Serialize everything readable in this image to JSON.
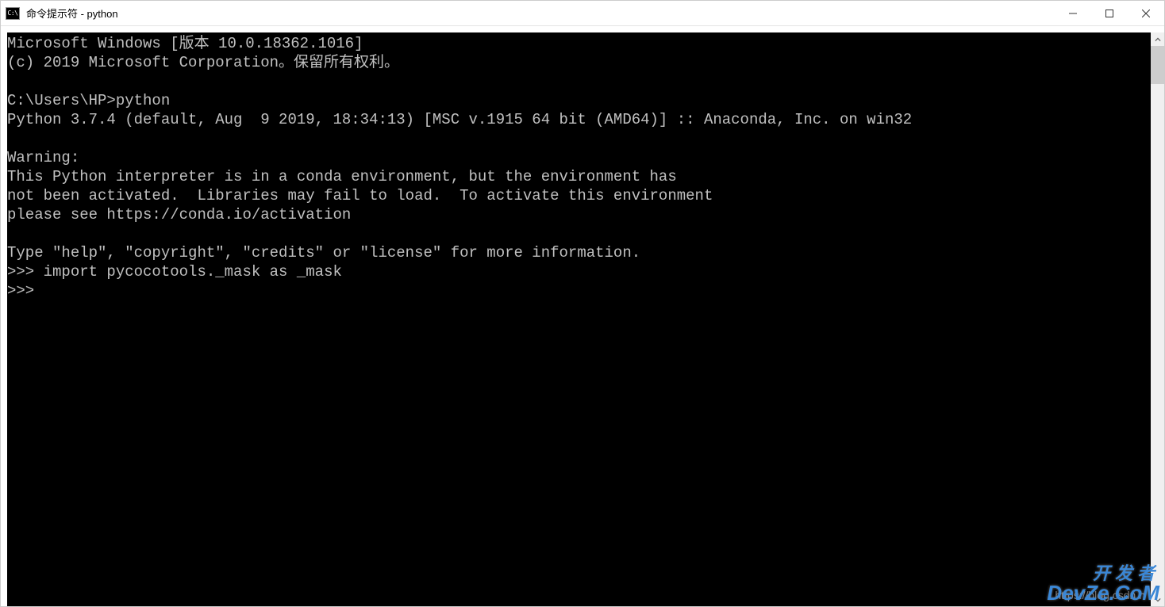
{
  "window": {
    "title": "命令提示符 - python",
    "icon_label": "C:\\"
  },
  "console": {
    "lines": [
      "Microsoft Windows [版本 10.0.18362.1016]",
      "(c) 2019 Microsoft Corporation。保留所有权利。",
      "",
      "C:\\Users\\HP>python",
      "Python 3.7.4 (default, Aug  9 2019, 18:34:13) [MSC v.1915 64 bit (AMD64)] :: Anaconda, Inc. on win32",
      "",
      "Warning:",
      "This Python interpreter is in a conda environment, but the environment has",
      "not been activated.  Libraries may fail to load.  To activate this environment",
      "please see https://conda.io/activation",
      "",
      "Type \"help\", \"copyright\", \"credits\" or \"license\" for more information.",
      ">>> import pycocotools._mask as _mask",
      ">>>"
    ]
  },
  "watermark": {
    "url": "https://blog.csdn.n",
    "logo_line1": "开发者",
    "logo_line2": "DevZe.CoM"
  }
}
